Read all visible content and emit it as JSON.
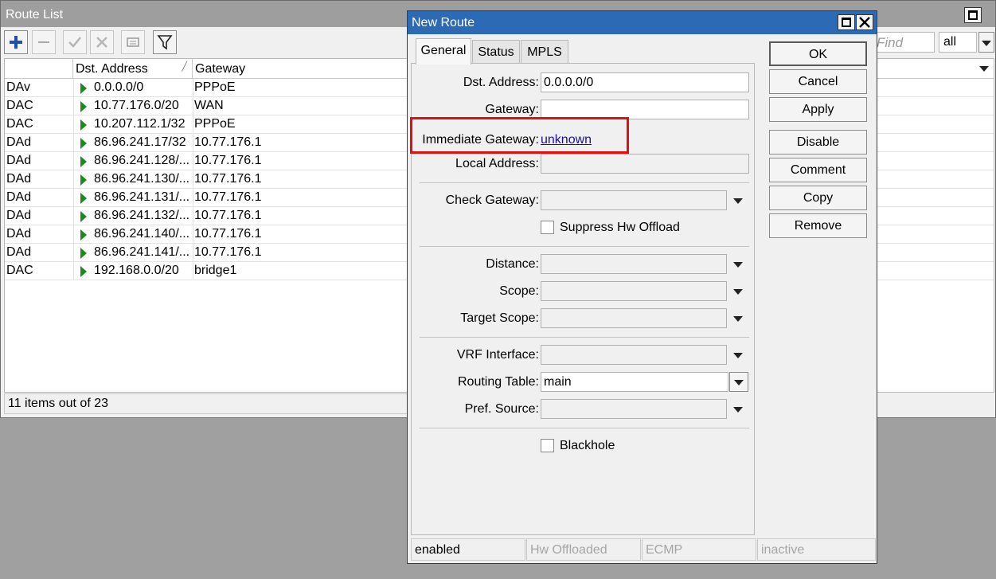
{
  "route_list": {
    "title": "Route List",
    "find_placeholder": "Find",
    "filter_value": "all",
    "columns": {
      "flags": "",
      "dst": "Dst. Address",
      "gateway": "Gateway"
    },
    "rows": [
      {
        "flags": "DAv",
        "dst": "0.0.0.0/0",
        "gateway": "PPPoE"
      },
      {
        "flags": "DAC",
        "dst": "10.77.176.0/20",
        "gateway": "WAN"
      },
      {
        "flags": "DAC",
        "dst": "10.207.112.1/32",
        "gateway": "PPPoE"
      },
      {
        "flags": "DAd",
        "dst": "86.96.241.17/32",
        "gateway": "10.77.176.1"
      },
      {
        "flags": "DAd",
        "dst": "86.96.241.128/...",
        "gateway": "10.77.176.1"
      },
      {
        "flags": "DAd",
        "dst": "86.96.241.130/...",
        "gateway": "10.77.176.1"
      },
      {
        "flags": "DAd",
        "dst": "86.96.241.131/...",
        "gateway": "10.77.176.1"
      },
      {
        "flags": "DAd",
        "dst": "86.96.241.132/...",
        "gateway": "10.77.176.1"
      },
      {
        "flags": "DAd",
        "dst": "86.96.241.140/...",
        "gateway": "10.77.176.1"
      },
      {
        "flags": "DAd",
        "dst": "86.96.241.141/...",
        "gateway": "10.77.176.1"
      },
      {
        "flags": "DAC",
        "dst": "192.168.0.0/20",
        "gateway": "bridge1"
      }
    ],
    "status": "11 items out of 23",
    "toolbar_icons": [
      "add-icon",
      "remove-icon",
      "enable-icon",
      "disable-icon",
      "comment-icon",
      "filter-icon"
    ]
  },
  "new_route": {
    "title": "New Route",
    "tabs": [
      "General",
      "Status",
      "MPLS"
    ],
    "active_tab": "General",
    "fields": {
      "dst_address": {
        "label": "Dst. Address:",
        "value": "0.0.0.0/0"
      },
      "gateway": {
        "label": "Gateway:",
        "value": ""
      },
      "immediate_gateway": {
        "label": "Immediate Gateway:",
        "value": "unknown"
      },
      "local_address": {
        "label": "Local Address:",
        "value": ""
      },
      "check_gateway": {
        "label": "Check Gateway:",
        "value": ""
      },
      "suppress_hw_offload": {
        "label": "Suppress Hw Offload",
        "checked": false
      },
      "distance": {
        "label": "Distance:",
        "value": ""
      },
      "scope": {
        "label": "Scope:",
        "value": ""
      },
      "target_scope": {
        "label": "Target Scope:",
        "value": ""
      },
      "vrf_interface": {
        "label": "VRF Interface:",
        "value": ""
      },
      "routing_table": {
        "label": "Routing Table:",
        "value": "main"
      },
      "pref_source": {
        "label": "Pref. Source:",
        "value": ""
      },
      "blackhole": {
        "label": "Blackhole",
        "checked": false
      }
    },
    "buttons": {
      "ok": "OK",
      "cancel": "Cancel",
      "apply": "Apply",
      "disable": "Disable",
      "comment": "Comment",
      "copy": "Copy",
      "remove": "Remove"
    },
    "status_bar": [
      "enabled",
      "Hw Offloaded",
      "ECMP",
      "inactive"
    ],
    "highlight_color": "#e01010",
    "title_color": "#2d6ab5",
    "route_icon_color": "#1d8a1d"
  }
}
